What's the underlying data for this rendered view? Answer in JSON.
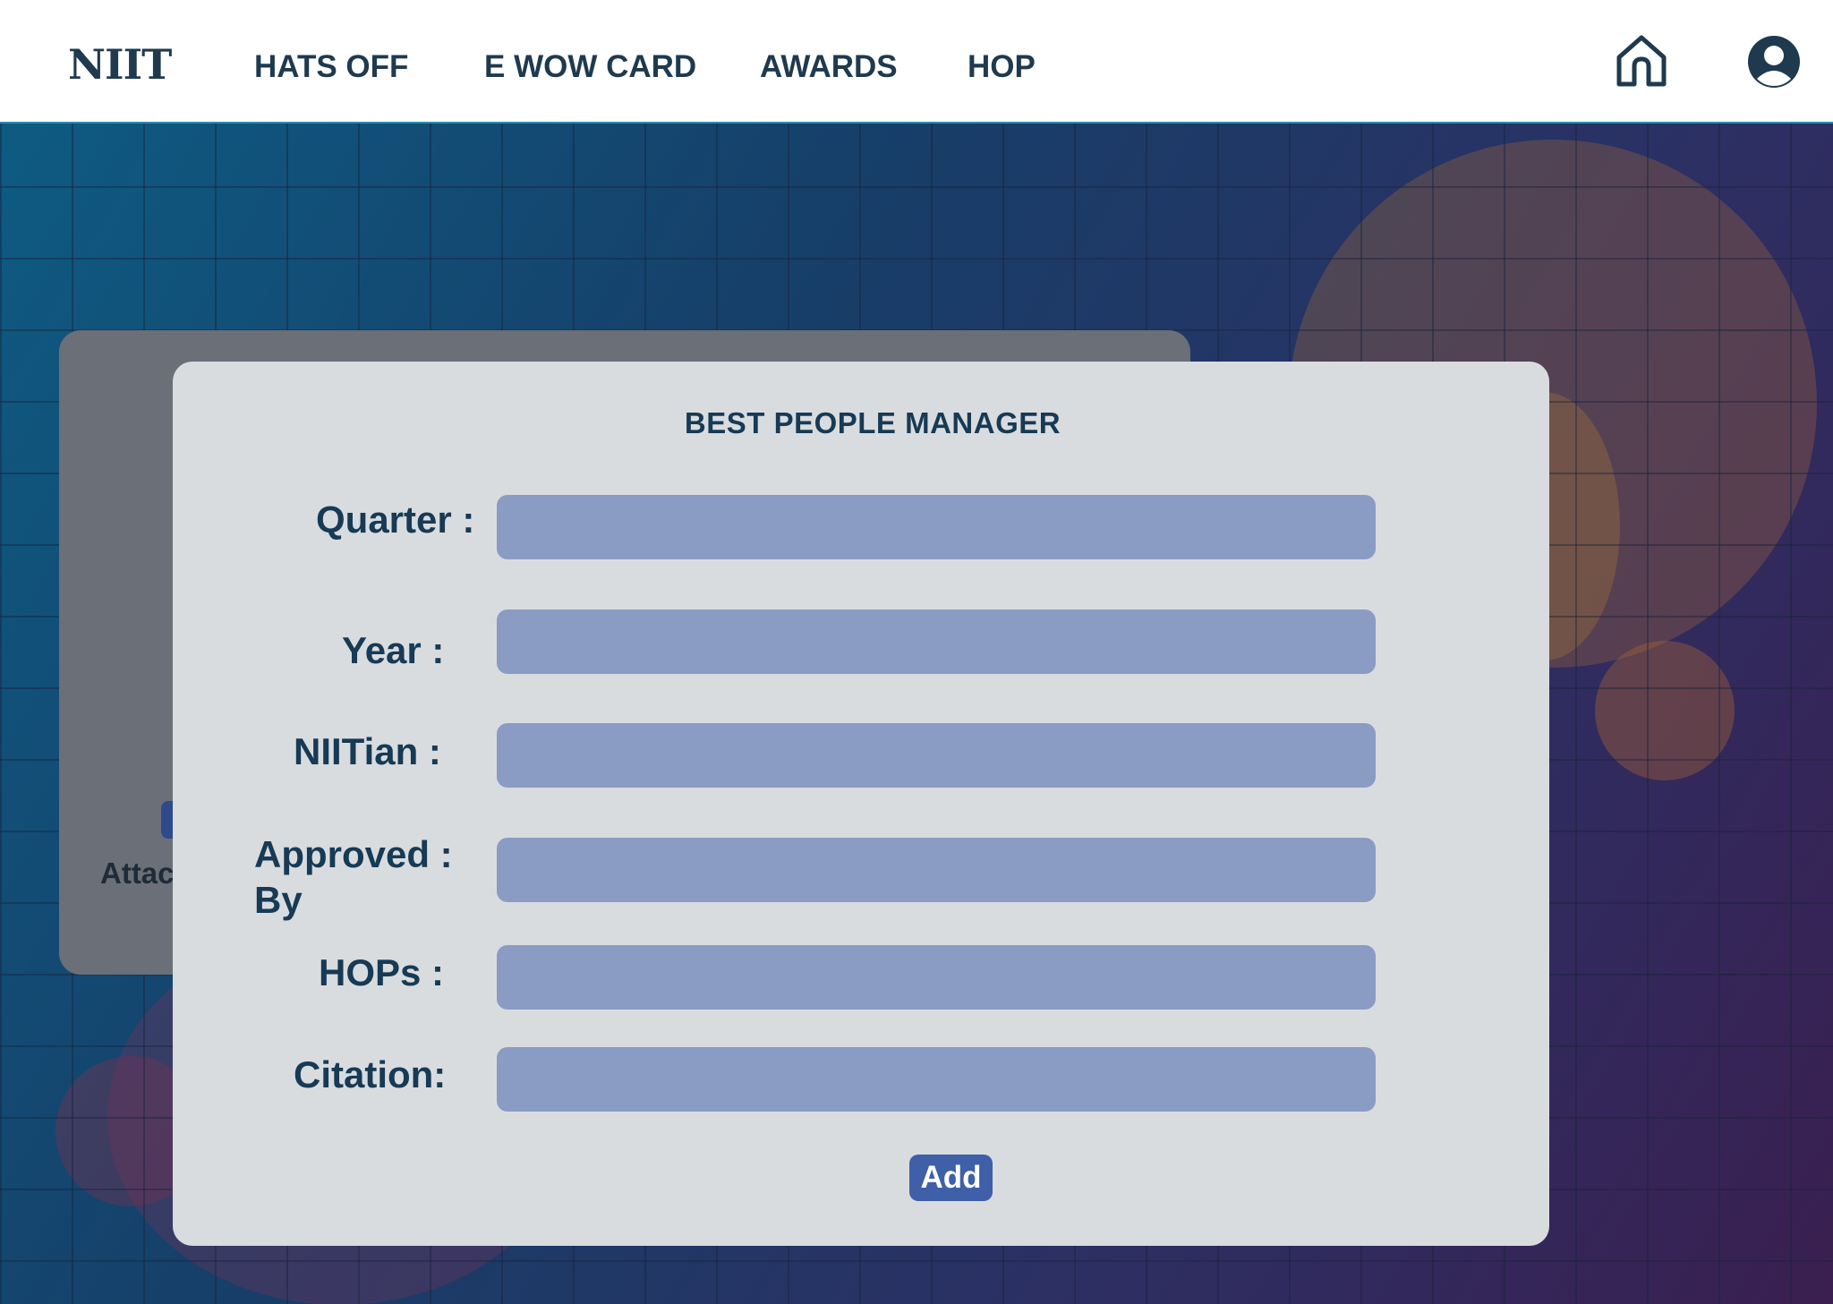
{
  "header": {
    "logo_text": "NIIT",
    "nav": [
      {
        "label": "HATS OFF"
      },
      {
        "label": "E WOW CARD"
      },
      {
        "label": "AWARDS"
      },
      {
        "label": "HOP"
      }
    ],
    "icons": {
      "home": "home-icon",
      "profile": "user-profile-icon"
    }
  },
  "background_card": {
    "label_fragment": "Attac"
  },
  "form": {
    "title": "BEST PEOPLE MANAGER",
    "fields": [
      {
        "label": "Quarter :",
        "value": ""
      },
      {
        "label": "Year :",
        "value": ""
      },
      {
        "label": "NIITian :",
        "value": ""
      },
      {
        "label_line1": "Approved :",
        "label_line2": "By",
        "value": ""
      },
      {
        "label": "HOPs :",
        "value": ""
      },
      {
        "label": "Citation:",
        "value": ""
      }
    ],
    "submit_label": "Add"
  },
  "colors": {
    "brand_text": "#1f3a4f",
    "input_fill": "#8a9cc4",
    "modal_bg": "#d9dcdf",
    "button_bg": "#3f5fa8",
    "accent_orange": "#c9772f"
  }
}
